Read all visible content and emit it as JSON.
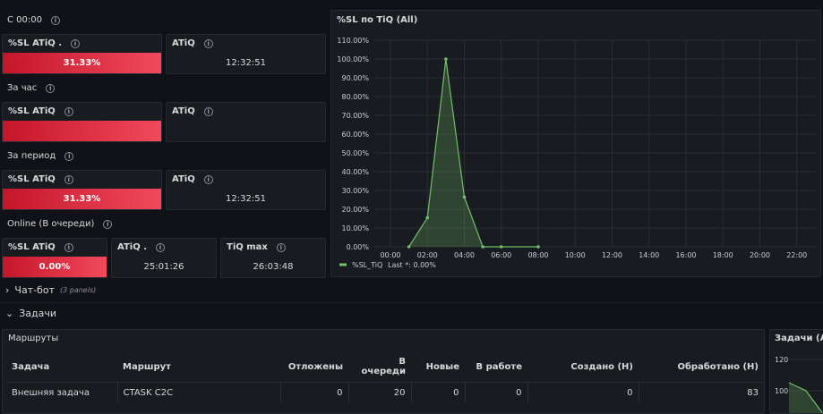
{
  "rows": {
    "current": "С 00:00",
    "hour": "За час",
    "period": "За период",
    "online": "Online (В очереди)"
  },
  "panels": {
    "sl_current": {
      "title": "%SL ATiQ .",
      "value": "31.33%"
    },
    "atiq_current": {
      "title": "ATiQ",
      "value": "12:32:51"
    },
    "sl_hour": {
      "title": "%SL ATiQ",
      "value": ""
    },
    "atiq_hour": {
      "title": "ATiQ",
      "value": ""
    },
    "sl_period": {
      "title": "%SL ATiQ",
      "value": "31.33%"
    },
    "atiq_period": {
      "title": "ATiQ",
      "value": "12:32:51"
    },
    "sl_online": {
      "title": "%SL ATiQ",
      "value": "0.00%"
    },
    "atiq_online": {
      "title": "ATiQ .",
      "value": "25:01:26"
    },
    "tiq_max": {
      "title": "TiQ max",
      "value": "26:03:48"
    }
  },
  "chart_panel": {
    "title": "%SL по TiQ (All)"
  },
  "chart_data": {
    "type": "area",
    "title": "%SL по TiQ (All)",
    "x_ticks": [
      "00:00",
      "02:00",
      "04:00",
      "06:00",
      "08:00",
      "10:00",
      "12:00",
      "14:00",
      "16:00",
      "18:00",
      "20:00",
      "22:00"
    ],
    "y_ticks": [
      "0.00%",
      "10.00%",
      "20.00%",
      "30.00%",
      "40.00%",
      "50.00%",
      "60.00%",
      "70.00%",
      "80.00%",
      "90.00%",
      "100.00%",
      "110.00%"
    ],
    "ylim": [
      0,
      110
    ],
    "xlim_hours": [
      0,
      24
    ],
    "grid": true,
    "legend_position": "bottom-left",
    "series": [
      {
        "name": "%SL_TiQ",
        "legend_suffix": "Last *: 0.00%",
        "color": "#73bf69",
        "points": [
          [
            1,
            0
          ],
          [
            2,
            15.5
          ],
          [
            3,
            100
          ],
          [
            4,
            26.5
          ],
          [
            5,
            0
          ],
          [
            6,
            0
          ],
          [
            8,
            0
          ]
        ]
      }
    ]
  },
  "chatbot_row": {
    "title": "Чат-бот",
    "meta": "(3 panels)"
  },
  "tasks_row": {
    "title": "Задачи"
  },
  "routes_panel": {
    "title": "Маршруты",
    "columns": [
      "Задача",
      "Маршрут",
      "Отложены",
      "В очереди",
      "Новые",
      "В работе",
      "Создано (Н)",
      "Обработано (Н)"
    ],
    "rows": [
      [
        "Внешняя задача",
        "CTASK C2C",
        "0",
        "20",
        "0",
        "0",
        "0",
        "83"
      ]
    ]
  },
  "tasks_panel": {
    "title": "Задачи (All)",
    "y_ticks": [
      "120",
      "100"
    ]
  },
  "colors": {
    "accent_red": "#f2495c",
    "series_green": "#73bf69",
    "panel_bg": "#181b1f"
  }
}
